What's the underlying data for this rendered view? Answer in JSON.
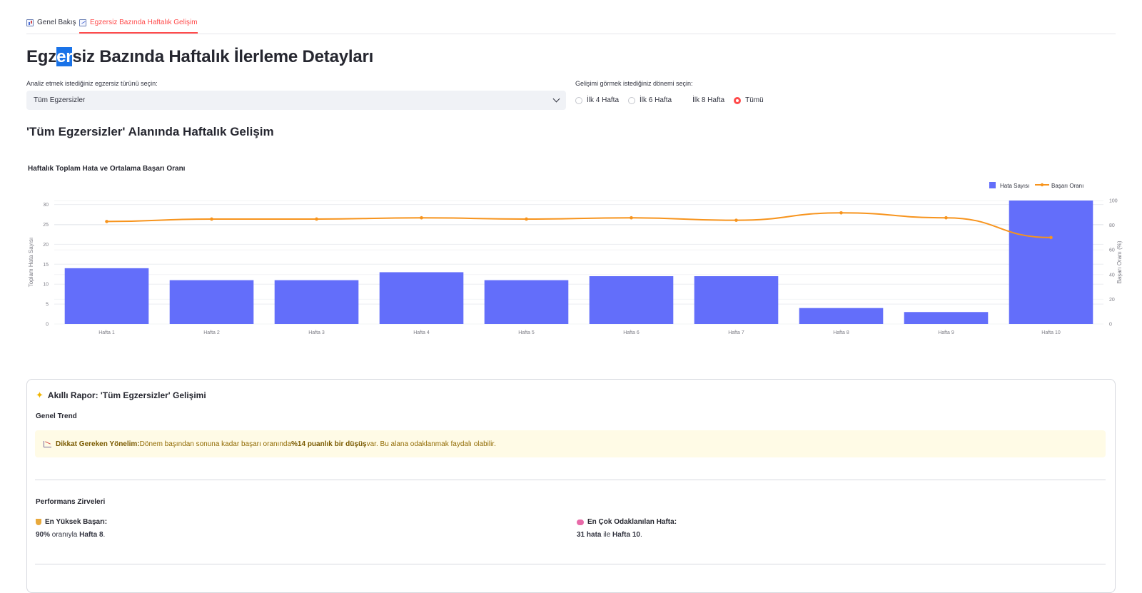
{
  "tabs": [
    {
      "label": "Genel Bakış",
      "icon": "bar-chart-icon",
      "active": false
    },
    {
      "label": "Egzersiz Bazında Haftalık Gelişim",
      "icon": "line-chart-icon",
      "active": true
    }
  ],
  "page_title": {
    "before": "Egz",
    "highlight": "er",
    "after": "siz Bazında Haftalık İlerleme Detayları"
  },
  "exercise_select": {
    "label": "Analiz etmek istediğiniz egzersiz türünü seçin:",
    "value": "Tüm Egzersizler"
  },
  "period": {
    "label": "Gelişimi görmek istediğiniz dönemi seçin:",
    "options": [
      "İlk 4 Hafta",
      "İlk 6 Hafta",
      "İlk 8 Hafta",
      "Tümü"
    ],
    "selected": "Tümü"
  },
  "section_title": "'Tüm Egzersizler' Alanında Haftalık Gelişim",
  "chart_data": {
    "type": "bar+line",
    "title": "Haftalık Toplam Hata ve Ortalama Başarı Oranı",
    "categories": [
      "Hafta 1",
      "Hafta 2",
      "Hafta 3",
      "Hafta 4",
      "Hafta 5",
      "Hafta 6",
      "Hafta 7",
      "Hafta 8",
      "Hafta 9",
      "Hafta 10"
    ],
    "series": [
      {
        "name": "Hata Sayısı",
        "type": "bar",
        "axis": "left",
        "values": [
          14,
          11,
          11,
          13,
          11,
          12,
          12,
          4,
          3,
          31
        ]
      },
      {
        "name": "Başarı Oranı",
        "type": "line",
        "axis": "right",
        "values": [
          83,
          85,
          85,
          86,
          85,
          86,
          84,
          90,
          86,
          70
        ]
      }
    ],
    "ylabel_left": "Toplam Hata Sayısı",
    "ylabel_right": "Başarı Oranı (%)",
    "ylim_left": [
      0,
      31
    ],
    "ylim_right": [
      0,
      100
    ],
    "yticks_left": [
      0,
      5,
      10,
      15,
      20,
      25,
      30
    ],
    "yticks_right": [
      0,
      20,
      40,
      60,
      80,
      100
    ],
    "legend": "top-right",
    "grid": true,
    "colors": {
      "bar": "#636efa",
      "line": "#f7941d"
    }
  },
  "report": {
    "title": "Akıllı Rapor: 'Tüm Egzersizler' Gelişimi",
    "trend_heading": "Genel Trend",
    "warning": {
      "label": "Dikkat Gereken Yönelim:",
      "text1": " Dönem başından sonuna kadar başarı oranında ",
      "emph": "%14 puanlık bir düşüş",
      "text2": " var. Bu alana odaklanmak faydalı olabilir."
    },
    "peaks_heading": "Performans Zirveleri",
    "highest": {
      "label": "En Yüksek Başarı:",
      "value_bold": "90%",
      "value_mid": " oranıyla ",
      "value_week": "Hafta 8",
      "value_end": "."
    },
    "focus": {
      "label": "En Çok Odaklanılan Hafta:",
      "value_bold": "31 hata",
      "value_mid": " ile ",
      "value_week": "Hafta 10",
      "value_end": "."
    }
  }
}
